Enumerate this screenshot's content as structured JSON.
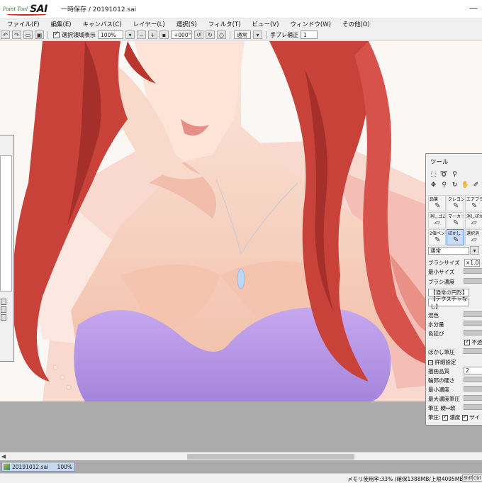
{
  "titlebar": {
    "logo_small": "Paint Tool",
    "logo_big": "SAI",
    "title": "一時保存 / 20191012.sai",
    "minimize": "—"
  },
  "menu": [
    "ファイル(F)",
    "編集(E)",
    "キャンバス(C)",
    "レイヤー(L)",
    "選択(S)",
    "フィルタ(T)",
    "ビュー(V)",
    "ウィンドウ(W)",
    "その他(O)"
  ],
  "toolbar": {
    "show_selection_label": "選択領域表示",
    "zoom": "100%",
    "rotation": "+000°",
    "blend_mode": "通常",
    "stabilizer_label": "手ブレ補正",
    "stabilizer_value": "1"
  },
  "tool_panel": {
    "title": "ツール",
    "brushes": [
      {
        "name": "鉛筆",
        "glyph": "✎"
      },
      {
        "name": "クレヨン",
        "glyph": "✎"
      },
      {
        "name": "エアブラシ",
        "glyph": "✎"
      },
      {
        "name": "消しゴム",
        "glyph": "▱"
      },
      {
        "name": "マーカー",
        "glyph": "✎"
      },
      {
        "name": "消しぼか",
        "glyph": "▱"
      },
      {
        "name": "2値ペン",
        "glyph": "✎"
      },
      {
        "name": "ぼかし",
        "glyph": "✎"
      },
      {
        "name": "選択消",
        "glyph": "▱"
      }
    ],
    "blend": "通常",
    "brush_size_label": "ブラシサイズ",
    "brush_size_mult": "×1.0",
    "min_size_label": "最小サイズ",
    "brush_density_label": "ブラシ濃度",
    "shape_label": "【通常の円形】",
    "texture_label": "【テクスチャなし】",
    "mix_label": "混色",
    "water_label": "水分量",
    "stretch_label": "色延び",
    "opacity_keep": "不透",
    "blur_pressure_label": "ぼかし筆圧",
    "detail_label": "詳細設定",
    "quality_label": "描画品質",
    "quality_value": "2",
    "edge_label": "輪郭の硬さ",
    "min_density_label": "最小濃度",
    "max_density_label": "最大濃度筆圧",
    "pressure_hardness_label": "筆圧 硬⇔軟",
    "pressure_label": "筆圧:",
    "pressure_density": "濃度",
    "pressure_size": "サイ"
  },
  "document": {
    "name": "20191012.sai",
    "zoom": "100%"
  },
  "status": {
    "memory": "メモリ使用率:33% (確保1388MB/上限4095MB)",
    "key_shift": "Shift",
    "key_ctrl": "Ctrl"
  },
  "colors": {
    "hair": "#c8423a",
    "skin": "#f6d2c0",
    "top": "#b494e4",
    "selected_brush": "#c9dcf5"
  }
}
